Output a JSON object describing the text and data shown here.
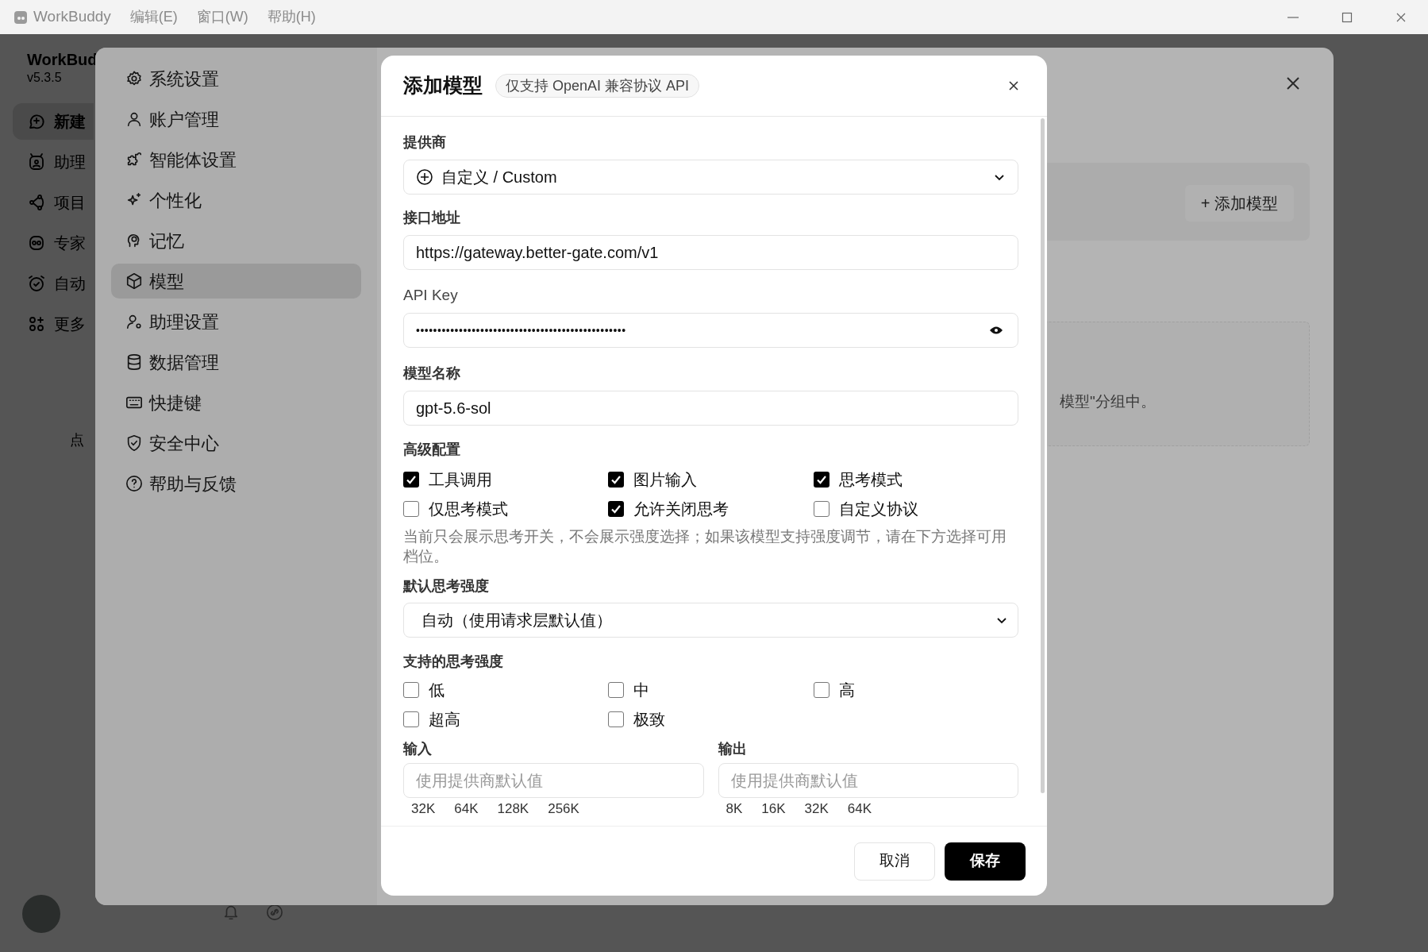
{
  "titlebar": {
    "app": "WorkBuddy",
    "menus": [
      "编辑(E)",
      "窗口(W)",
      "帮助(H)"
    ]
  },
  "app_sidebar": {
    "brand": "WorkBud",
    "version": "v5.3.5",
    "items": [
      {
        "label": "新建",
        "selected": true
      },
      {
        "label": "助理",
        "selected": false
      },
      {
        "label": "项目",
        "selected": false
      },
      {
        "label": "专家",
        "selected": false
      },
      {
        "label": "自动",
        "selected": false
      },
      {
        "label": "更多",
        "selected": false
      }
    ],
    "hint": "点"
  },
  "settings": {
    "menu": [
      {
        "label": "系统设置",
        "selected": false
      },
      {
        "label": "账户管理",
        "selected": false
      },
      {
        "label": "智能体设置",
        "selected": false
      },
      {
        "label": "个性化",
        "selected": false
      },
      {
        "label": "记忆",
        "selected": false
      },
      {
        "label": "模型",
        "selected": true
      },
      {
        "label": "助理设置",
        "selected": false
      },
      {
        "label": "数据管理",
        "selected": false
      },
      {
        "label": "快捷键",
        "selected": false
      },
      {
        "label": "安全中心",
        "selected": false
      },
      {
        "label": "帮助与反馈",
        "selected": false
      }
    ],
    "add_button": "+ 添加模型",
    "empty_text": "模型\"分组中。"
  },
  "dialog": {
    "title": "添加模型",
    "badge": "仅支持 OpenAI 兼容协议 API",
    "provider_label": "提供商",
    "provider": "自定义 / Custom",
    "endpoint_label": "接口地址",
    "endpoint": "https://gateway.better-gate.com/v1",
    "api_key_label": "API Key",
    "api_key": "•••••••••••••••••••••••••••••••••••••••••••••••••",
    "model_name_label": "模型名称",
    "model_name": "gpt-5.6-sol",
    "advanced_label": "高级配置",
    "advanced": [
      {
        "label": "工具调用",
        "checked": true
      },
      {
        "label": "图片输入",
        "checked": true
      },
      {
        "label": "思考模式",
        "checked": true
      },
      {
        "label": "仅思考模式",
        "checked": false
      },
      {
        "label": "允许关闭思考",
        "checked": true
      },
      {
        "label": "自定义协议",
        "checked": false
      }
    ],
    "hint": "当前只会展示思考开关，不会展示强度选择；如果该模型支持强度调节，请在下方选择可用档位。",
    "default_effort_label": "默认思考强度",
    "default_effort": "自动（使用请求层默认值）",
    "efforts_label": "支持的思考强度",
    "efforts": [
      {
        "label": "低",
        "checked": false
      },
      {
        "label": "中",
        "checked": false
      },
      {
        "label": "高",
        "checked": false
      },
      {
        "label": "超高",
        "checked": false
      },
      {
        "label": "极致",
        "checked": false
      }
    ],
    "input_label": "输入",
    "input_placeholder": "使用提供商默认值",
    "input_presets": [
      "32K",
      "64K",
      "128K",
      "256K"
    ],
    "output_label": "输出",
    "output_placeholder": "使用提供商默认值",
    "output_presets": [
      "8K",
      "16K",
      "32K",
      "64K"
    ],
    "cancel": "取消",
    "save": "保存"
  }
}
